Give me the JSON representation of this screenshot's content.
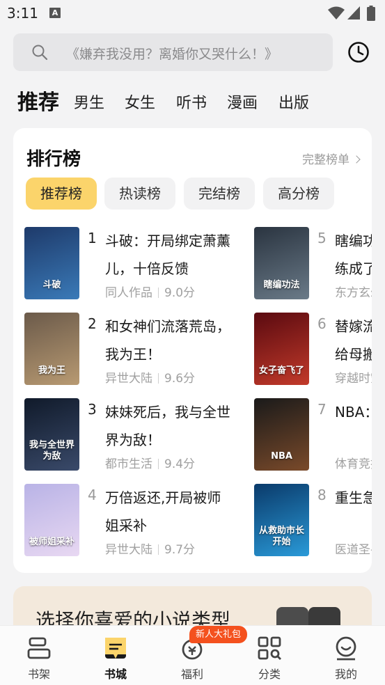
{
  "status_bar": {
    "time": "3:11",
    "notif_letter": "A"
  },
  "search": {
    "placeholder": "《嫌弃我没用？离婚你又哭什么！》"
  },
  "category_tabs": [
    {
      "label": "推荐",
      "active": true
    },
    {
      "label": "男生"
    },
    {
      "label": "女生"
    },
    {
      "label": "听书"
    },
    {
      "label": "漫画"
    },
    {
      "label": "出版"
    }
  ],
  "ranking": {
    "title": "排行榜",
    "more_label": "完整榜单",
    "tabs": [
      {
        "label": "推荐榜",
        "active": true
      },
      {
        "label": "热读榜"
      },
      {
        "label": "完结榜"
      },
      {
        "label": "高分榜"
      }
    ],
    "books": [
      {
        "rank": "1",
        "title": "斗破：开局绑定萧薰儿，十倍反馈",
        "genre": "同人作品",
        "score": "9.0分",
        "cover_text": "斗破",
        "cover_colors": [
          "#1e3a6a",
          "#3a7ab8"
        ]
      },
      {
        "rank": "2",
        "title": "和女神们流落荒岛，我为王！",
        "genre": "异世大陆",
        "score": "9.6分",
        "cover_text": "我为王",
        "cover_colors": [
          "#6b5a4a",
          "#b89a72"
        ]
      },
      {
        "rank": "3",
        "title": "妹妹死后，我与全世界为敌！",
        "genre": "都市生活",
        "score": "9.4分",
        "cover_text": "我与全世界为敌",
        "cover_colors": [
          "#101a2a",
          "#3a4a6a"
        ]
      },
      {
        "rank": "4",
        "title": "万倍返还,开局被师姐采补",
        "genre": "异世大陆",
        "score": "9.7分",
        "cover_text": "被师姐采补",
        "cover_colors": [
          "#b9b3e6",
          "#e8d8f2"
        ]
      },
      {
        "rank": "5",
        "title": "瞎编功法，徒儿你真练成了？",
        "genre": "东方玄幻",
        "score": "",
        "cover_text": "瞎编功法",
        "cover_colors": [
          "#2a3440",
          "#6a7a88"
        ]
      },
      {
        "rank": "6",
        "title": "替嫁流放，带着空间给母搬空",
        "genre": "穿越时空",
        "score": "",
        "cover_text": "女子奋飞了",
        "cover_colors": [
          "#5a0a10",
          "#c23a2a"
        ]
      },
      {
        "rank": "7",
        "title": "NBA：分体验",
        "genre": "体育竞技",
        "score": "",
        "cover_text": "NBA",
        "cover_colors": [
          "#1a1a1a",
          "#7a4a2a"
        ]
      },
      {
        "rank": "8",
        "title": "重生急诊，挽救市长",
        "genre": "医道圣手",
        "score": "",
        "cover_text": "从救助市长开始",
        "cover_colors": [
          "#0a3a6a",
          "#2a9ad8"
        ]
      }
    ]
  },
  "promo": {
    "text": "选择你喜爱的小说类型"
  },
  "bottom_nav": {
    "badge": "新人大礼包",
    "items": [
      {
        "label": "书架",
        "icon": "bookshelf-icon"
      },
      {
        "label": "书城",
        "icon": "bookstore-icon",
        "active": true
      },
      {
        "label": "福利",
        "icon": "welfare-icon"
      },
      {
        "label": "分类",
        "icon": "category-icon"
      },
      {
        "label": "我的",
        "icon": "profile-icon"
      }
    ]
  }
}
